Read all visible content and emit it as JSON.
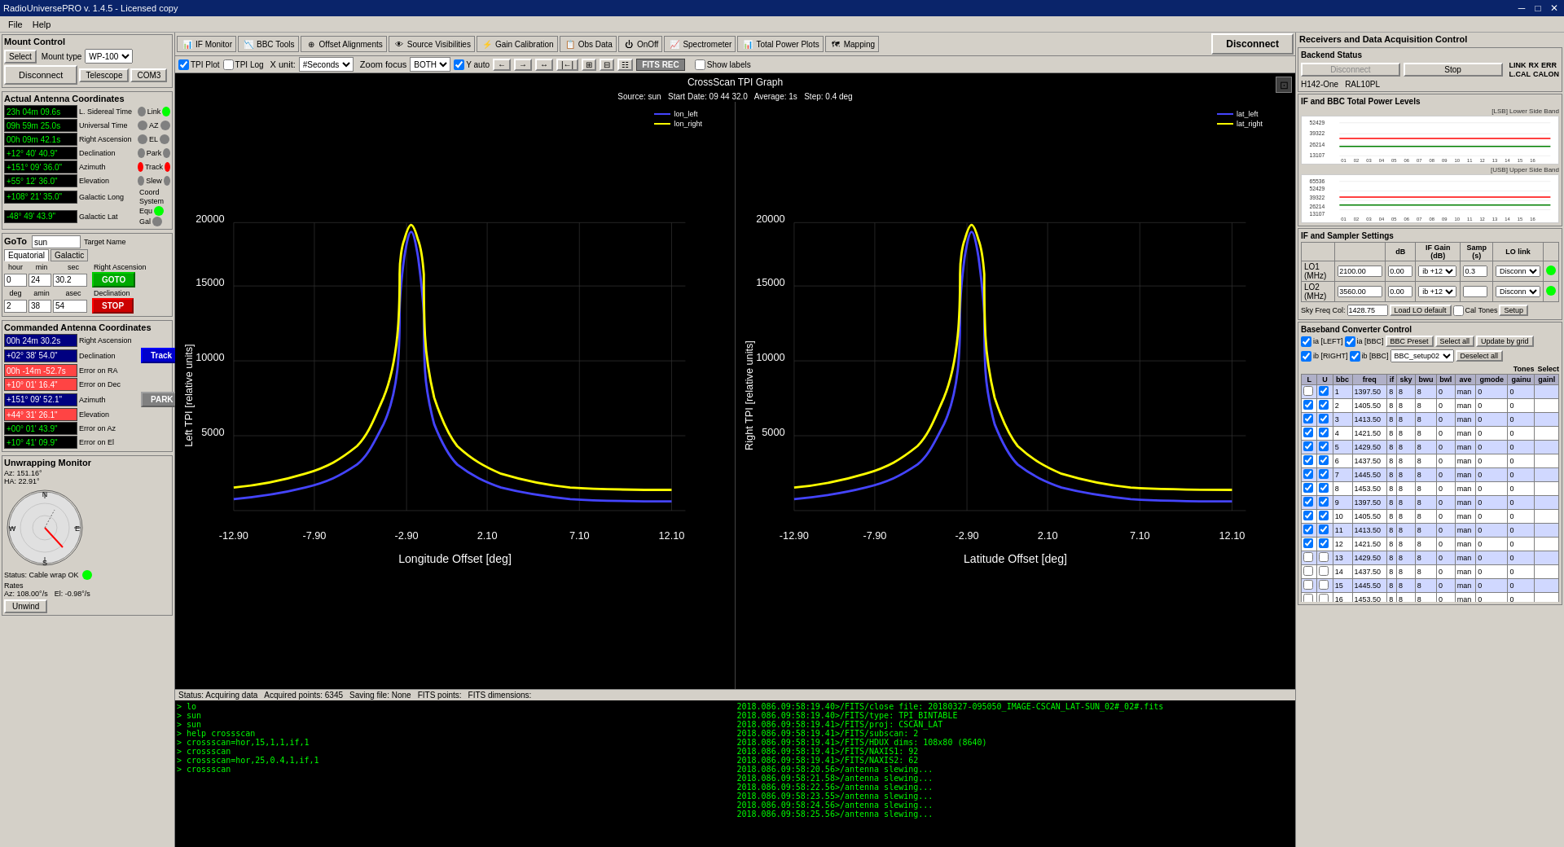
{
  "titlebar": {
    "title": "RadioUniversePRO v. 1.4.5 - Licensed copy",
    "minimize": "─",
    "maximize": "□",
    "close": "✕"
  },
  "menubar": {
    "items": [
      "File",
      "Help"
    ]
  },
  "mount_control": {
    "title": "Mount Control",
    "select_label": "Select",
    "mount_type_label": "Mount type",
    "mount_type_value": "WP-100",
    "telescope_label": "Telescope",
    "com3_label": "COM3",
    "disconnect_label": "Disconnect",
    "actual_coords_title": "Actual Antenna Coordinates",
    "sidereal_time": "23h 04m 09.6s",
    "sidereal_label": "L. Sidereal Time",
    "universal_time": "09h 59m 25.0s",
    "universal_label": "Universal Time",
    "ra": "00h 09m 42.1s",
    "ra_label": "Right Ascension",
    "dec": "+12° 40' 40.9\"",
    "dec_label": "Declination",
    "az": "+151° 09' 36.0\"",
    "az_label": "Azimuth",
    "el": "+55° 12' 36.0\"",
    "el_label": "Elevation",
    "gal_long": "+108° 21' 35.0\"",
    "gal_long_label": "Galactic Long",
    "gal_lat": "-48° 49' 43.9\"",
    "gal_lat_label": "Galactic Lat",
    "goto_label": "GoTo",
    "target": "sun",
    "target_name_label": "Target Name",
    "equatorial_label": "Equatorial",
    "galactic_label": "Galactic",
    "hour_label": "hour",
    "min_label": "min",
    "sec_label": "sec",
    "hour_val": "0",
    "min_val": "24",
    "sec_val": "30.2",
    "ra_goto_label": "Right Ascension",
    "deg_label": "deg",
    "amin_label": "amin",
    "asec_label": "asec",
    "deg_val": "2",
    "amin_val": "38",
    "asec_val": "54",
    "dec_goto_label": "Declination",
    "goto_btn": "GOTO",
    "stop_btn": "STOP",
    "commanded_title": "Commanded Antenna Coordinates",
    "cmd_ra": "00h 24m 30.2s",
    "cmd_ra_label": "Right Ascension",
    "cmd_dec": "+02° 38' 54.0\"",
    "cmd_dec_label": "Declination",
    "err_ra": "00h -14m -52.7s",
    "err_ra_label": "Error on RA",
    "err_dec": "+10° 01' 16.4\"",
    "err_dec_label": "Error on Dec",
    "cmd_az": "+151° 09' 52.1\"",
    "cmd_az_label": "Azimuth",
    "cmd_el": "+44° 31' 26.1\"",
    "cmd_el_label": "Elevation",
    "err_az": "+00° 01' 43.9\"",
    "err_az_label": "Error on Az",
    "err_el": "+10° 41' 09.9\"",
    "err_el_label": "Error on El",
    "track_btn": "Track",
    "park_btn": "PARK",
    "unwrap_title": "Unwrapping Monitor",
    "az_val": "Az: 151.16°",
    "ha_val": "HA: 22.91°",
    "status_cable": "Status: Cable wrap OK",
    "rates_label": "Rates",
    "az_rate": "Az: 108.00°/s",
    "el_rate": "El: -0.98°/s",
    "unwind_btn": "Unwind"
  },
  "toolbar": {
    "if_monitor": "IF Monitor",
    "bbc_tools": "BBC Tools",
    "offset_alignments": "Offset Alignments",
    "source_visibilities": "Source Visibilities",
    "gain_calibration": "Gain Calibration",
    "obs_data": "Obs Data",
    "on_off": "OnOff",
    "spectrometer": "Spectrometer",
    "total_power_plots": "Total Power Plots",
    "mapping": "Mapping"
  },
  "toolbar2": {
    "tpi_plot": "TPI Plot",
    "tpi_log": "TPI Log",
    "x_unit_label": "X unit:",
    "x_unit_value": "#Seconds",
    "zoom_focus_label": "Zoom focus",
    "zoom_focus_value": "BOTH",
    "y_auto": "Y auto",
    "fits_rec": "FITS REC",
    "show_labels": "Show labels"
  },
  "graph": {
    "title": "CrossScan TPI Graph",
    "source_label": "Source: sun",
    "start_date_label": "Start Date: 09 44 32.0",
    "average_label": "Average: 1s",
    "step_label": "Step: 0.4 deg",
    "left_legend_1": "lon_left",
    "left_legend_2": "lon_right",
    "right_legend_1": "lat_left",
    "right_legend_2": "lat_right",
    "left_yaxis": "Left TPI [relative units]",
    "right_yaxis": "Right TPI [relative units]",
    "x_axis_left": "Longitude Offset [deg]",
    "x_axis_right": "Latitude Offset [deg]",
    "y_max": "20000",
    "y_15000": "15000",
    "y_10000": "10000",
    "y_5000": "5000",
    "x_labels": [
      "-12.90",
      "-7.90",
      "-2.90",
      "2.10",
      "7.10",
      "12.10"
    ]
  },
  "status_bar": {
    "status": "Status: Acquiring data",
    "acquired": "Acquired points: 6345",
    "saving": "Saving file: None",
    "fits_points": "FITS points:",
    "fits_dims": "FITS dimensions:"
  },
  "console_left": {
    "lines": [
      "> lo",
      "> sun",
      "> sun",
      "> help crossscan",
      "> crossscan=hor,15,1,1,if,1",
      "> crossscan",
      "> crossscan=hor,25,0.4,1,if,1",
      "> crossscan"
    ]
  },
  "console_right": {
    "lines": [
      "2018.086.09:58:19.40>/FITS/close file: 20180327-095050_IMAGE-CSCAN_LAT-SUN_02#_02#.fits",
      "2018.086.09:58:19.40>/FITS/type: TPI_BINTABLE",
      "2018.086.09:58:19.41>/FITS/proj: CSCAN_LAT",
      "2018.086.09:58:19.41>/FITS/subscan: 2",
      "2018.086.09:58:19.41>/FITS/HDUX dims: 108x80 (8640)",
      "2018.086.09:58:19.41>/FITS/NAXIS1: 92",
      "2018.086.09:58:19.41>/FITS/NAXIS2: 62",
      "2018.086.09:58:20.56>/antenna slewing...",
      "2018.086.09:58:21.58>/antenna slewing...",
      "2018.086.09:58:22.56>/antenna slewing...",
      "2018.086.09:58:23.55>/antenna slewing...",
      "2018.086.09:58:24.56>/antenna slewing...",
      "2018.086.09:58:25.56>/antenna slewing..."
    ]
  },
  "right_panel": {
    "title": "Receivers and Data Acquisition Control",
    "backend_title": "Backend Status",
    "disconnect_btn": "Disconnect",
    "stop_btn": "Stop",
    "link_label": "LINK",
    "rx_label": "RX",
    "err_label": "ERR",
    "l_cal_label": "L.CAL",
    "calon_label": "CALON",
    "device_label": "H142-One",
    "device2_label": "RAL10PL",
    "power_levels_title": "IF and BBC Total Power Levels",
    "lsb_label": "[LSB] Lower Side Band",
    "usb_label": "[USB] Upper Side Band",
    "y_vals_lsb": [
      "52429",
      "39322",
      "26214",
      "13107"
    ],
    "x_labels_lsb": [
      "01",
      "02",
      "03",
      "04",
      "05",
      "06",
      "07",
      "08",
      "09",
      "10",
      "11",
      "12",
      "13",
      "14",
      "15",
      "16"
    ],
    "y_vals_usb": [
      "65536",
      "52429",
      "39322",
      "26214",
      "13107"
    ],
    "x_labels_usb": [
      "01",
      "02",
      "03",
      "04",
      "05",
      "06",
      "07",
      "08",
      "09",
      "10",
      "11",
      "12",
      "13",
      "14",
      "15",
      "16"
    ],
    "if_settings_title": "IF and Sampler Settings",
    "db_label": "dB",
    "if_gain_label": "IF Gain (dB)",
    "samp_label": "Samp (s)",
    "lo_link_label": "LO link",
    "lo1_label": "LO1 (MHz)",
    "lo1_freq": "2100.00",
    "lo1_db": "0.00",
    "lo1_gain": "ib +12",
    "lo1_samp": "0.3",
    "lo1_link": "Disconn",
    "lo2_label": "LO2 (MHz)",
    "lo2_freq": "3560.00",
    "lo2_db": "0.00",
    "lo2_gain": "ib +12",
    "lo2_samp": "",
    "lo2_link": "Disconn",
    "sky_freq_label": "Sky Freq Col:",
    "sky_freq_val": "1428.75",
    "load_lo_btn": "Load LO default",
    "cal_tones_chk": "Cal Tones",
    "setup_btn": "Setup",
    "bbc_title": "Baseband Converter Control",
    "ia_left_chk": "ia [LEFT]",
    "ia_bbc_chk": "ia [BBC]",
    "bbc_preset_btn": "BBC Preset",
    "select_all_btn": "Select all",
    "update_btn": "Update by grid",
    "ib_right_chk": "ib [RIGHT]",
    "ib_bbc_chk": "ib [BBC]",
    "bbc_setup_val": "BBC_setup02",
    "deselect_all_btn": "Deselect all",
    "tones_label": "Tones",
    "select_label": "Select",
    "bbc_cols": [
      "L",
      "U",
      "bbc",
      "freq",
      "if",
      "sky",
      "bwu",
      "bwl",
      "ave",
      "gmode",
      "gainu",
      "gainl"
    ],
    "bbc_rows": [
      {
        "l": false,
        "u": true,
        "bbc": "1",
        "freq": "1397.50",
        "if": "8",
        "sky": "8",
        "bwu": "8",
        "bwl": "0",
        "ave": "man",
        "gmode": "0",
        "gainu": "0",
        "gainl": ""
      },
      {
        "l": true,
        "u": true,
        "bbc": "2",
        "freq": "1405.50",
        "if": "8",
        "sky": "8",
        "bwu": "8",
        "bwl": "0",
        "ave": "man",
        "gmode": "0",
        "gainu": "0",
        "gainl": ""
      },
      {
        "l": true,
        "u": true,
        "bbc": "3",
        "freq": "1413.50",
        "if": "8",
        "sky": "8",
        "bwu": "8",
        "bwl": "0",
        "ave": "man",
        "gmode": "0",
        "gainu": "0",
        "gainl": ""
      },
      {
        "l": true,
        "u": true,
        "bbc": "4",
        "freq": "1421.50",
        "if": "8",
        "sky": "8",
        "bwu": "8",
        "bwl": "0",
        "ave": "man",
        "gmode": "0",
        "gainu": "0",
        "gainl": ""
      },
      {
        "l": true,
        "u": true,
        "bbc": "5",
        "freq": "1429.50",
        "if": "8",
        "sky": "8",
        "bwu": "8",
        "bwl": "0",
        "ave": "man",
        "gmode": "0",
        "gainu": "0",
        "gainl": ""
      },
      {
        "l": true,
        "u": true,
        "bbc": "6",
        "freq": "1437.50",
        "if": "8",
        "sky": "8",
        "bwu": "8",
        "bwl": "0",
        "ave": "man",
        "gmode": "0",
        "gainu": "0",
        "gainl": ""
      },
      {
        "l": true,
        "u": true,
        "bbc": "7",
        "freq": "1445.50",
        "if": "8",
        "sky": "8",
        "bwu": "8",
        "bwl": "0",
        "ave": "man",
        "gmode": "0",
        "gainu": "0",
        "gainl": ""
      },
      {
        "l": true,
        "u": true,
        "bbc": "8",
        "freq": "1453.50",
        "if": "8",
        "sky": "8",
        "bwu": "8",
        "bwl": "0",
        "ave": "man",
        "gmode": "0",
        "gainu": "0",
        "gainl": ""
      },
      {
        "l": true,
        "u": true,
        "bbc": "9",
        "freq": "1397.50",
        "if": "8",
        "sky": "8",
        "bwu": "8",
        "bwl": "0",
        "ave": "man",
        "gmode": "0",
        "gainu": "0",
        "gainl": ""
      },
      {
        "l": true,
        "u": true,
        "bbc": "10",
        "freq": "1405.50",
        "if": "8",
        "sky": "8",
        "bwu": "8",
        "bwl": "0",
        "ave": "man",
        "gmode": "0",
        "gainu": "0",
        "gainl": ""
      },
      {
        "l": true,
        "u": true,
        "bbc": "11",
        "freq": "1413.50",
        "if": "8",
        "sky": "8",
        "bwu": "8",
        "bwl": "0",
        "ave": "man",
        "gmode": "0",
        "gainu": "0",
        "gainl": ""
      },
      {
        "l": true,
        "u": true,
        "bbc": "12",
        "freq": "1421.50",
        "if": "8",
        "sky": "8",
        "bwu": "8",
        "bwl": "0",
        "ave": "man",
        "gmode": "0",
        "gainu": "0",
        "gainl": ""
      },
      {
        "l": false,
        "u": false,
        "bbc": "13",
        "freq": "1429.50",
        "if": "8",
        "sky": "8",
        "bwu": "8",
        "bwl": "0",
        "ave": "man",
        "gmode": "0",
        "gainu": "0",
        "gainl": ""
      },
      {
        "l": false,
        "u": false,
        "bbc": "14",
        "freq": "1437.50",
        "if": "8",
        "sky": "8",
        "bwu": "8",
        "bwl": "0",
        "ave": "man",
        "gmode": "0",
        "gainu": "0",
        "gainl": ""
      },
      {
        "l": false,
        "u": false,
        "bbc": "15",
        "freq": "1445.50",
        "if": "8",
        "sky": "8",
        "bwu": "8",
        "bwl": "0",
        "ave": "man",
        "gmode": "0",
        "gainu": "0",
        "gainl": ""
      },
      {
        "l": false,
        "u": false,
        "bbc": "16",
        "freq": "1453.50",
        "if": "8",
        "sky": "8",
        "bwu": "8",
        "bwl": "0",
        "ave": "man",
        "gmode": "0",
        "gainu": "0",
        "gainl": ""
      }
    ]
  }
}
